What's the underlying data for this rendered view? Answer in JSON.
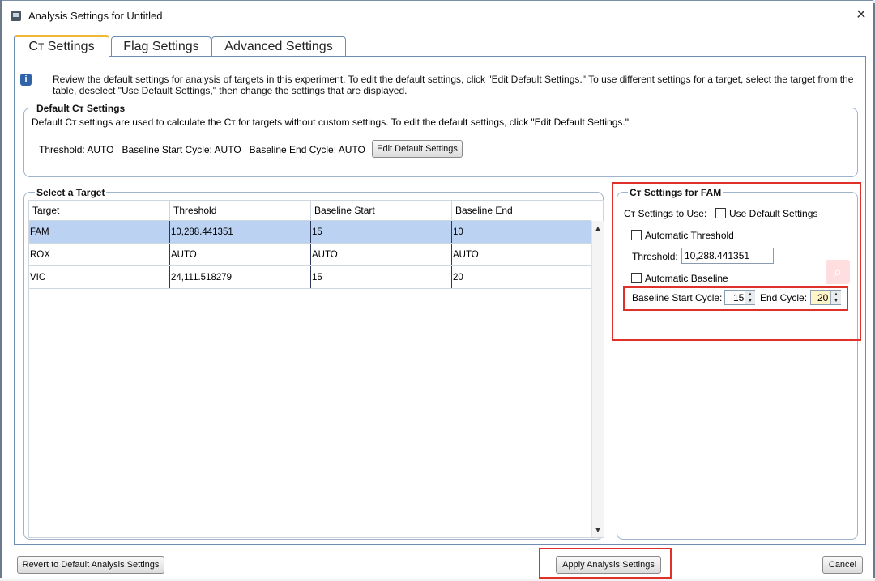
{
  "window": {
    "title": "Analysis Settings for Untitled"
  },
  "tabs": [
    {
      "label": "Cт Settings",
      "active": true
    },
    {
      "label": "Flag Settings",
      "active": false
    },
    {
      "label": "Advanced Settings",
      "active": false
    }
  ],
  "info": {
    "text": "Review the default settings for analysis of targets in this experiment. To edit the default settings, click \"Edit Default Settings.\" To use different settings for a target, select the target from the table, deselect \"Use Default Settings,\" then change the settings that are displayed."
  },
  "default_settings": {
    "group_label": "Default Cт Settings",
    "description": "Default Cт settings are used to calculate the Cт for targets without custom settings. To edit the default settings, click \"Edit Default Settings.\"",
    "summary": "Threshold: AUTO   Baseline Start Cycle: AUTO   Baseline End Cycle: AUTO",
    "edit_button": "Edit Default Settings"
  },
  "targets": {
    "group_label": "Select a Target",
    "columns": [
      "Target",
      "Threshold",
      "Baseline Start",
      "Baseline End"
    ],
    "rows": [
      {
        "target": "FAM",
        "threshold": "10,288.441351",
        "start": "15",
        "end": "10",
        "selected": true
      },
      {
        "target": "ROX",
        "threshold": "AUTO",
        "start": "AUTO",
        "end": "AUTO",
        "selected": false
      },
      {
        "target": "VIC",
        "threshold": "24,111.518279",
        "start": "15",
        "end": "20",
        "selected": false
      }
    ]
  },
  "target_settings": {
    "group_label": "Cт Settings for FAM",
    "settings_to_use_label": "Cт Settings to Use:",
    "use_default_label": "Use Default Settings",
    "use_default_checked": false,
    "auto_threshold_label": "Automatic Threshold",
    "auto_threshold_checked": false,
    "threshold_label": "Threshold:",
    "threshold_value": "10,288.441351",
    "auto_baseline_label": "Automatic Baseline",
    "auto_baseline_checked": false,
    "baseline_start_label": "Baseline Start Cycle:",
    "baseline_start_value": "15",
    "end_cycle_label": "End Cycle:",
    "end_cycle_value": "20"
  },
  "footer": {
    "revert_button": "Revert to Default Analysis Settings",
    "apply_button": "Apply Analysis Settings",
    "cancel_button": "Cancel"
  },
  "colors": {
    "selected_row": "#bcd2f2",
    "highlight_red": "#e0302a",
    "active_tab_accent": "#f0b838"
  }
}
